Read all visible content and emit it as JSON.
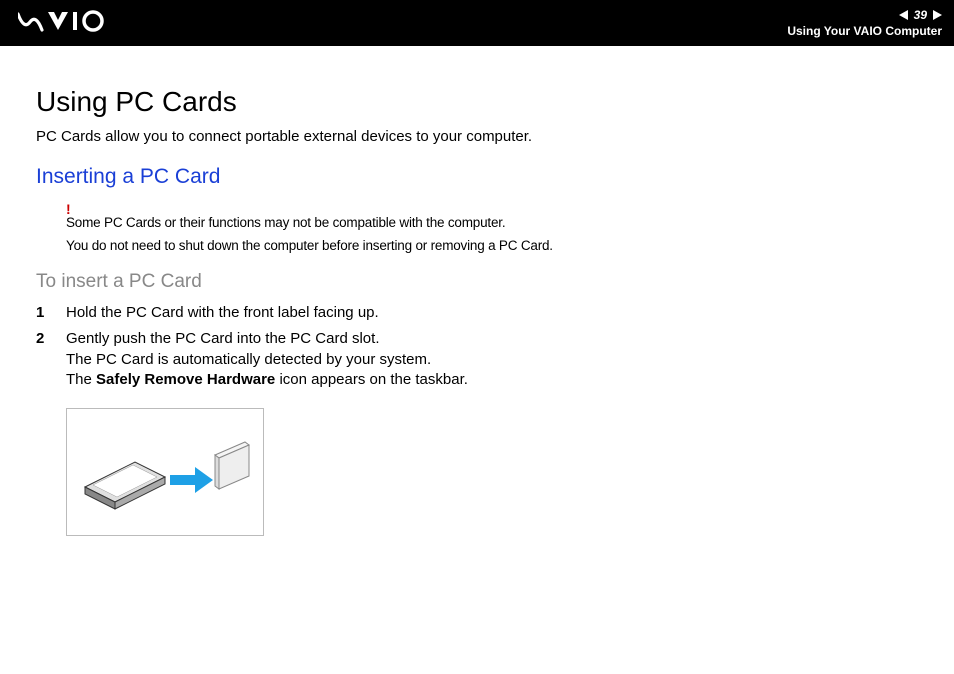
{
  "header": {
    "page_num": "39",
    "section": "Using Your VAIO Computer"
  },
  "content": {
    "title": "Using PC Cards",
    "intro": "PC Cards allow you to connect portable external devices to your computer.",
    "sub_heading": "Inserting a PC Card",
    "warning_mark": "!",
    "warning1": "Some PC Cards or their functions may not be compatible with the computer.",
    "warning2": "You do not need to shut down the computer before inserting or removing a PC Card.",
    "task_heading": "To insert a PC Card",
    "steps": {
      "s1": {
        "num": "1",
        "text": "Hold the PC Card with the front label facing up."
      },
      "s2": {
        "num": "2",
        "line1": "Gently push the PC Card into the PC Card slot.",
        "line2": "The PC Card is automatically detected by your system.",
        "line3a": "The ",
        "line3b": "Safely Remove Hardware",
        "line3c": " icon appears on the taskbar."
      }
    }
  }
}
